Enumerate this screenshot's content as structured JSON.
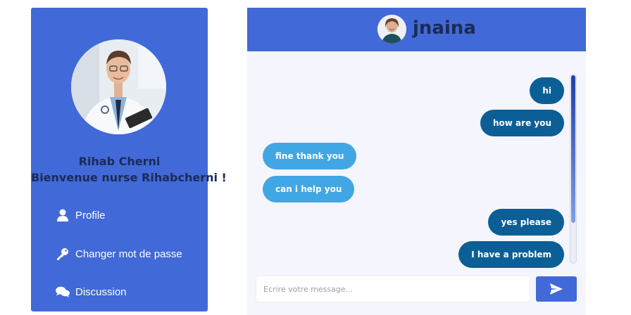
{
  "sidebar": {
    "user_name": "Rihab Cherni",
    "welcome": "Bienvenue nurse Rihabcherni !",
    "nav": [
      {
        "label": "Profile",
        "icon": "user-icon"
      },
      {
        "label": "Changer mot de passe",
        "icon": "key-icon"
      },
      {
        "label": "Discussion",
        "icon": "comments-icon"
      }
    ]
  },
  "chat": {
    "contact_name": "jnaina",
    "messages": [
      {
        "text": "hi",
        "direction": "sent"
      },
      {
        "text": "how are you",
        "direction": "sent"
      },
      {
        "text": "fine thank you",
        "direction": "received"
      },
      {
        "text": "can i help you",
        "direction": "received"
      },
      {
        "text": "yes please",
        "direction": "sent"
      },
      {
        "text": "I have a problem",
        "direction": "sent"
      }
    ],
    "input_placeholder": "Ecrire votre message...",
    "send_icon": "send-icon"
  },
  "colors": {
    "primary": "#4169d8",
    "sent_bubble": "#0b5f96",
    "received_bubble": "#41a7e4",
    "chat_background": "#f4f5fd",
    "title_text": "#1c2b55"
  }
}
